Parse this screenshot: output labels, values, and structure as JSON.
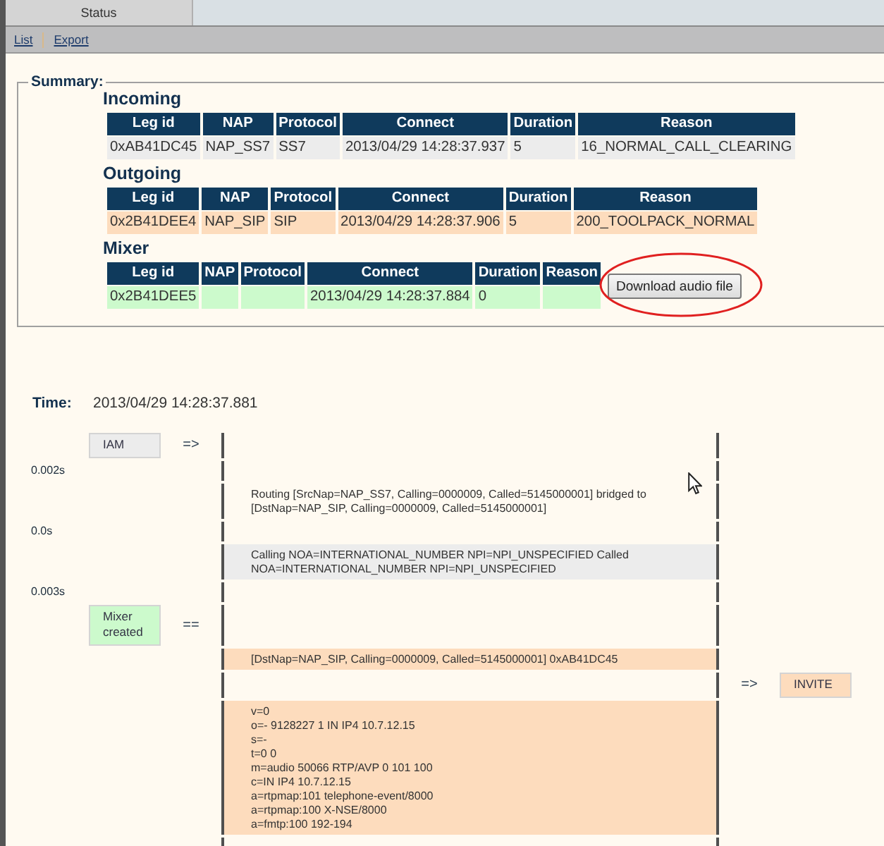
{
  "tabs": [
    {
      "label": "Status",
      "selected": true
    }
  ],
  "links": [
    "List",
    "Export"
  ],
  "summary": {
    "legend": "Summary:",
    "sections": [
      {
        "title": "Incoming",
        "kind": "incoming",
        "columns": [
          "Leg id",
          "NAP",
          "Protocol",
          "Connect",
          "Duration",
          "Reason"
        ],
        "rows": [
          [
            "0xAB41DC45",
            "NAP_SS7",
            "SS7",
            "2013/04/29 14:28:37.937",
            "5",
            "16_NORMAL_CALL_CLEARING"
          ]
        ]
      },
      {
        "title": "Outgoing",
        "kind": "outgoing",
        "columns": [
          "Leg id",
          "NAP",
          "Protocol",
          "Connect",
          "Duration",
          "Reason"
        ],
        "rows": [
          [
            "0x2B41DEE4",
            "NAP_SIP",
            "SIP",
            "2013/04/29 14:28:37.906",
            "5",
            "200_TOOLPACK_NORMAL"
          ]
        ]
      },
      {
        "title": "Mixer",
        "kind": "mixer",
        "columns": [
          "Leg id",
          "NAP",
          "Protocol",
          "Connect",
          "Duration",
          "Reason"
        ],
        "rows": [
          [
            "0x2B41DEE5",
            null,
            null,
            "2013/04/29 14:28:37.884",
            "0",
            null
          ]
        ],
        "button": {
          "label": "Download audio file",
          "circled": true
        }
      }
    ]
  },
  "time": {
    "label": "Time:",
    "value": "2013/04/29 14:28:37.881"
  },
  "flow": {
    "rows": [
      {
        "left": {
          "text": "IAM",
          "kind": "incoming"
        },
        "left_arrow": "=>"
      },
      {
        "time": "0.002s"
      },
      {
        "center": {
          "text": "Routing [SrcNap=NAP_SS7, Calling=0000009, Called=5145000001] bridged to [DstNap=NAP_SIP, Calling=0000009, Called=5145000001]"
        }
      },
      {
        "time": "0.0s"
      },
      {
        "center": {
          "text": "Calling NOA=INTERNATIONAL_NUMBER NPI=NPI_UNSPECIFIED Called NOA=INTERNATIONAL_NUMBER NPI=NPI_UNSPECIFIED",
          "kind": "incoming"
        }
      },
      {
        "time": "0.003s"
      },
      {
        "left": {
          "text": "Mixer created",
          "kind": "mixer"
        },
        "left_arrow": "=="
      },
      {
        "center": {
          "text": "[DstNap=NAP_SIP, Calling=0000009, Called=5145000001] 0xAB41DC45",
          "kind": "outgoing"
        }
      },
      {
        "right_arrow": "=>",
        "right": {
          "text": "INVITE",
          "kind": "outgoing"
        }
      },
      {
        "center": {
          "lines": [
            "v=0",
            "o=- 9128227 1 IN IP4 10.7.12.15",
            "s=-",
            "t=0 0",
            "m=audio 50066 RTP/AVP 0 101 100",
            "c=IN IP4 10.7.12.15",
            "a=rtpmap:101 telephone-event/8000",
            "a=rtpmap:100 X-NSE/8000",
            "a=fmtp:100 192-194"
          ],
          "kind": "outgoing"
        }
      }
    ]
  }
}
